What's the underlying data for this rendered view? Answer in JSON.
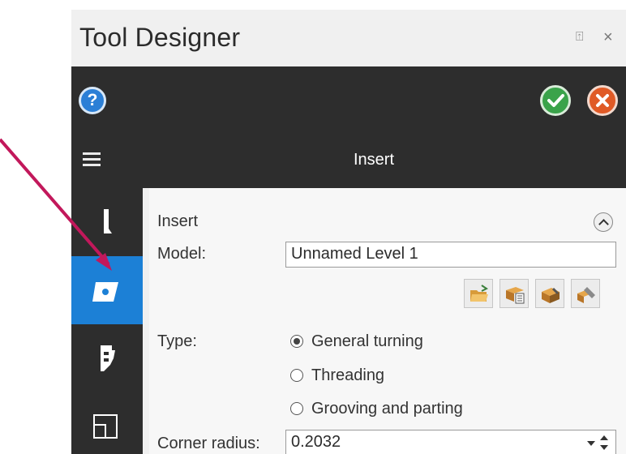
{
  "window": {
    "title": "Tool Designer",
    "pin_glyph": "⍐",
    "close_glyph": "×"
  },
  "toolbar": {
    "help_icon": "help-icon",
    "help_glyph": "?",
    "ok_icon": "checkmark-icon",
    "cancel_icon": "close-icon",
    "colors": {
      "help": "#2b7fd6",
      "ok": "#3aa34a",
      "cancel": "#e05a26"
    }
  },
  "nav": {
    "title": "Insert",
    "menu_icon": "hamburger-icon"
  },
  "sidebar": {
    "items": [
      {
        "icon": "holder-icon",
        "active": false
      },
      {
        "icon": "insert-icon",
        "active": true
      },
      {
        "icon": "assembly-icon",
        "active": false
      },
      {
        "icon": "layout-icon",
        "active": false
      }
    ],
    "active_color": "#1c80d6"
  },
  "insert": {
    "section_title": "Insert",
    "model_label": "Model:",
    "model_value": "Unnamed Level 1",
    "type_label": "Type:",
    "type_options": [
      {
        "label": "General turning",
        "checked": true
      },
      {
        "label": "Threading",
        "checked": false
      },
      {
        "label": "Grooving and parting",
        "checked": false
      }
    ],
    "corner_radius_label": "Corner radius:",
    "corner_radius_value": "0.2032",
    "model_buttons": [
      "open-folder-icon",
      "library-icon",
      "save-icon",
      "edit-icon"
    ]
  },
  "annotation": {
    "arrow_color": "#c2185b"
  }
}
